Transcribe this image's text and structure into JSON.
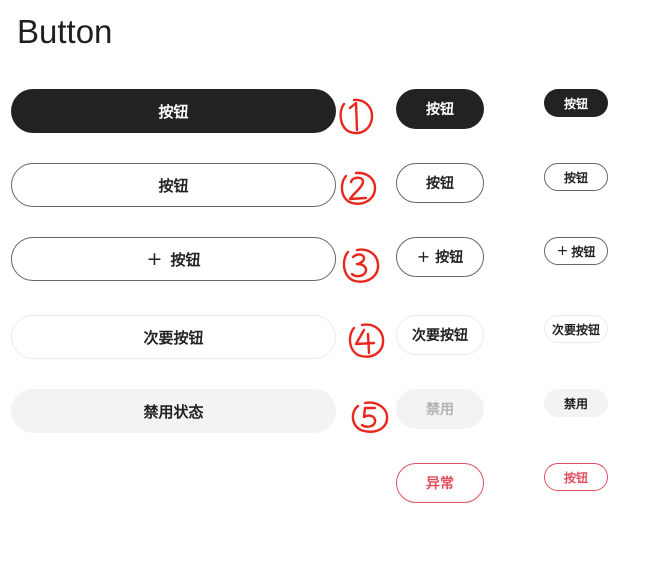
{
  "page": {
    "title": "Button"
  },
  "rows": {
    "primary": {
      "large": "按钮",
      "medium": "按钮",
      "small": "按钮"
    },
    "outline": {
      "large": "按钮",
      "medium": "按钮",
      "small": "按钮"
    },
    "icon": {
      "icon": "plus-icon",
      "large": "按钮",
      "medium": "按钮",
      "small": "按钮"
    },
    "secondary": {
      "large": "次要按钮",
      "medium": "次要按钮",
      "small": "次要按钮"
    },
    "disabled": {
      "large": "禁用状态",
      "medium": "禁用",
      "small": "禁用"
    },
    "danger": {
      "medium": "异常",
      "small": "按钮"
    }
  },
  "annotations": [
    "1",
    "2",
    "3",
    "4",
    "5"
  ],
  "colors": {
    "primary_bg": "#222222",
    "outline_border": "#666666",
    "disabled_bg": "#f3f3f3",
    "danger": "#e0505e",
    "annotation": "#e8281e"
  }
}
